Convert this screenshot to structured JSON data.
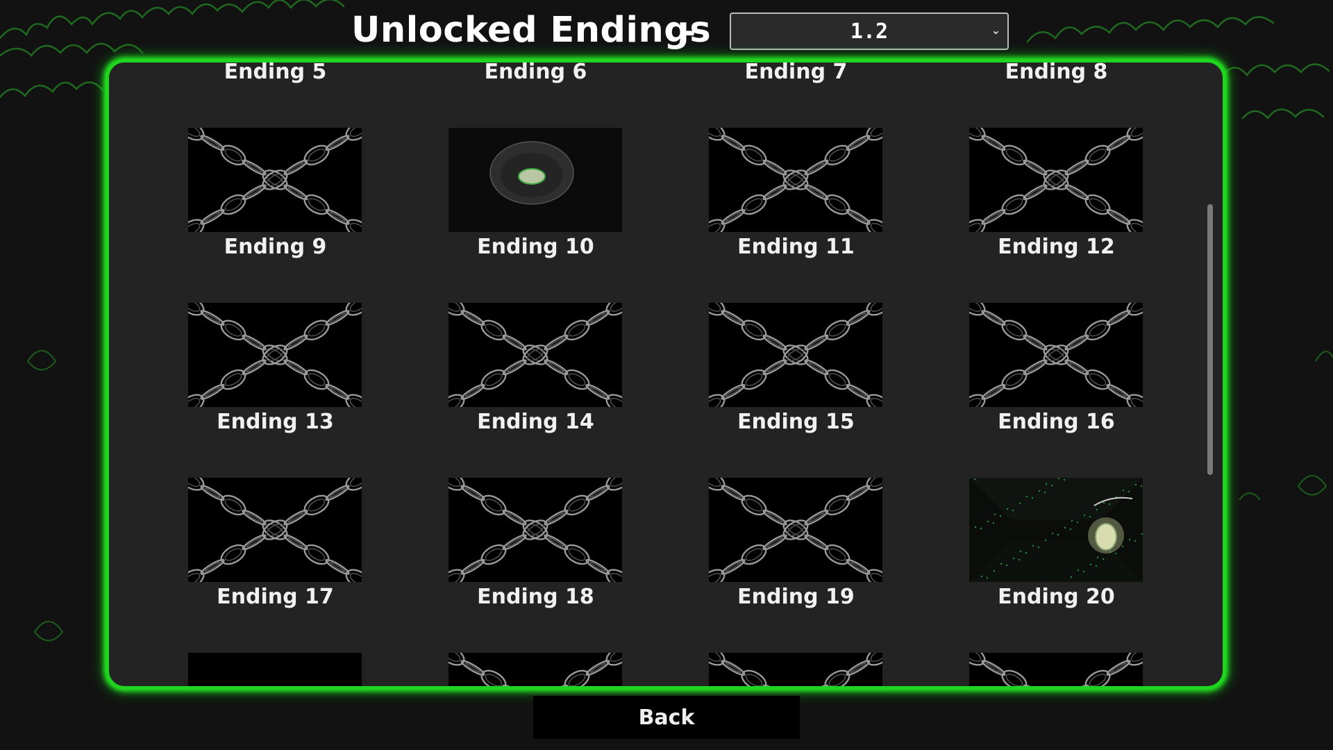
{
  "header": {
    "title": "Unlocked Endings",
    "separator": "-",
    "version_select": {
      "value": "1.2",
      "chevron_icon": "chevron-down-icon"
    }
  },
  "colors": {
    "accent": "#1fd61f",
    "panel": "#232323",
    "background": "#121212"
  },
  "endings": {
    "top_labels": [
      "Ending 5",
      "Ending 6",
      "Ending 7",
      "Ending 8"
    ],
    "rows": [
      [
        {
          "image": "chains-icon"
        },
        {
          "image": "plate-icon"
        },
        {
          "image": "chains-icon"
        },
        {
          "image": "chains-icon"
        }
      ],
      [
        {
          "image": "chains-icon"
        },
        {
          "image": "chains-icon"
        },
        {
          "image": "chains-icon"
        },
        {
          "image": "chains-icon"
        }
      ],
      [
        {
          "image": "chains-icon"
        },
        {
          "image": "chains-icon"
        },
        {
          "image": "chains-icon"
        },
        {
          "image": "lantern-corridor-icon"
        }
      ],
      [
        {
          "image": "blank"
        },
        {
          "image": "chains-icon"
        },
        {
          "image": "chains-icon"
        },
        {
          "image": "chains-icon"
        }
      ]
    ],
    "row_labels": [
      [
        "Ending 9",
        "Ending 10",
        "Ending 11",
        "Ending 12"
      ],
      [
        "Ending 13",
        "Ending 14",
        "Ending 15",
        "Ending 16"
      ],
      [
        "Ending 17",
        "Ending 18",
        "Ending 19",
        "Ending 20"
      ]
    ]
  },
  "footer": {
    "back_label": "Back"
  }
}
